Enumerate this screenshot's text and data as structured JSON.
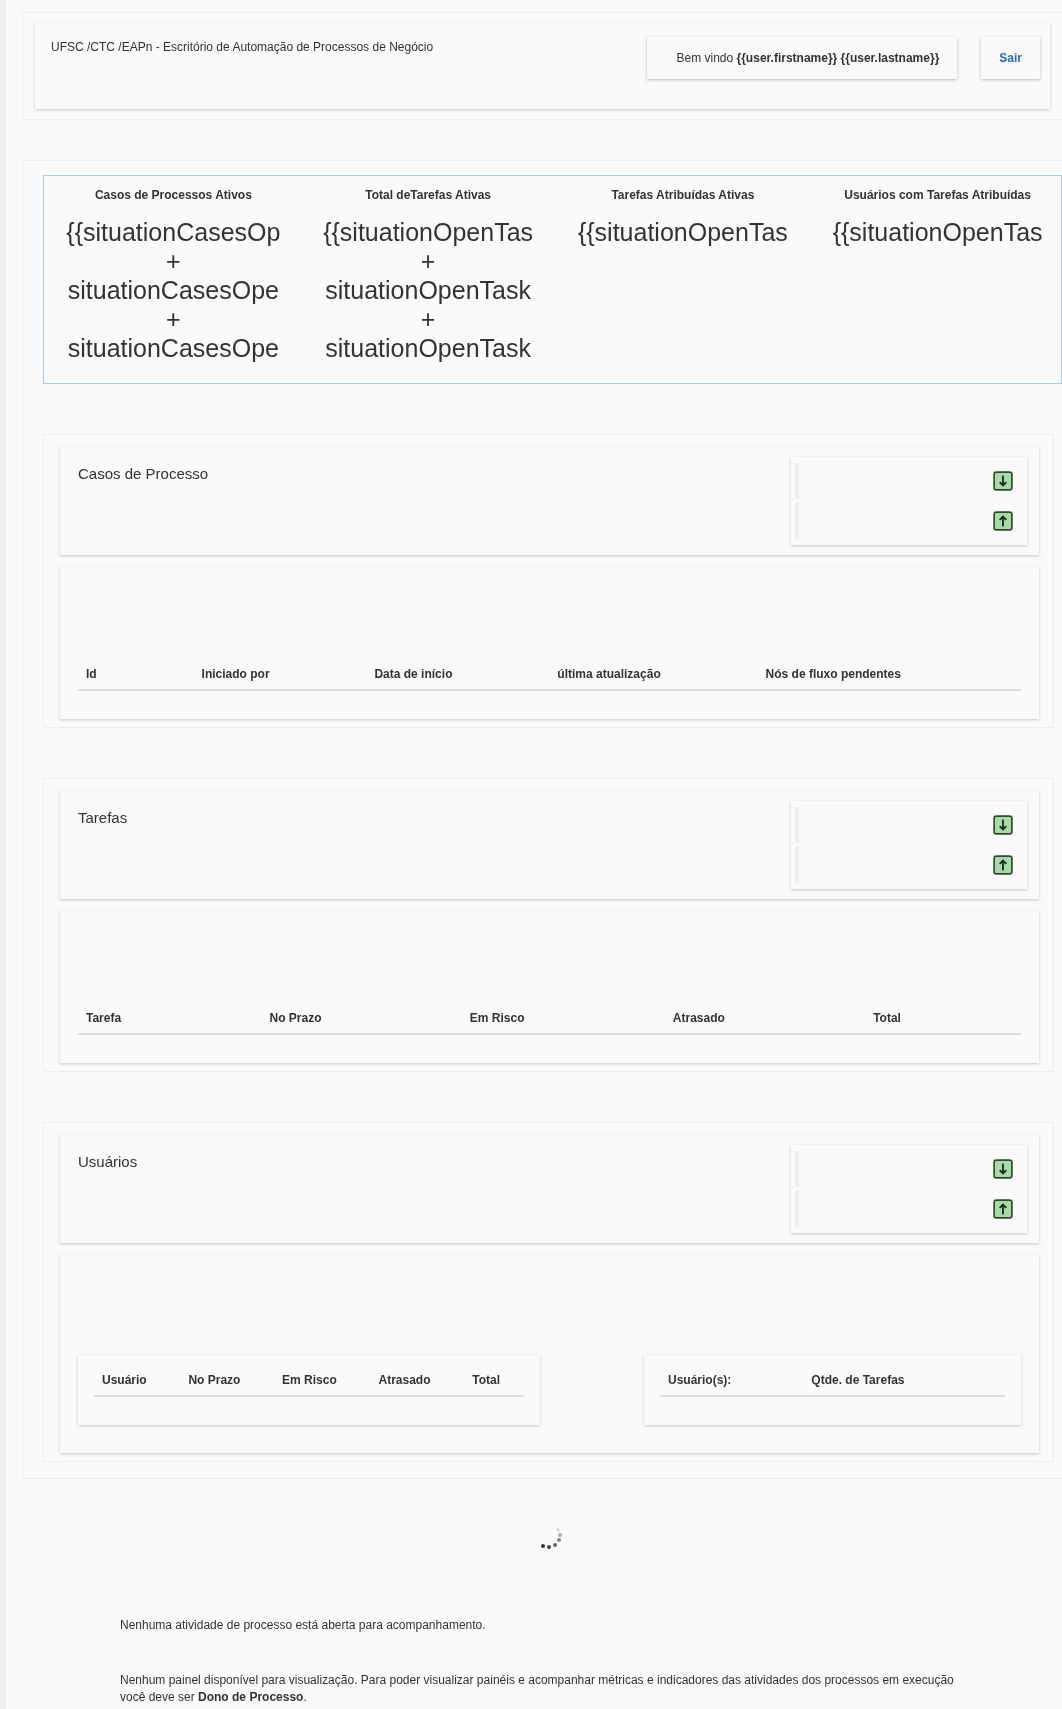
{
  "header": {
    "brand": "UFSC /CTC /EAPn - Escritório de Automação de Processos de Negócio",
    "welcome": "Bem vindo **{{user.firstname}} {{user.lastname}}**",
    "logout": "Sair"
  },
  "stats": [
    {
      "label": "Casos de Processos Ativos",
      "lines": [
        "{{situationCasesOp",
        "+",
        "situationCasesOpe",
        "+",
        "situationCasesOpe"
      ]
    },
    {
      "label": "Total deTarefas Ativas",
      "lines": [
        "{{situationOpenTas",
        "+",
        "situationOpenTask",
        "+",
        "situationOpenTask"
      ]
    },
    {
      "label": "Tarefas Atribuídas Ativas",
      "lines": [
        "{{situationOpenTas"
      ]
    },
    {
      "label": "Usuários com Tarefas Atribuídas",
      "lines": [
        "{{situationOpenTas"
      ]
    }
  ],
  "sections": [
    {
      "title": "Casos de Processo",
      "tables": [
        {
          "columns": [
            "Id",
            "Iniciado por",
            "Data de início",
            "última atualização",
            "Nós de fluxo pendentes"
          ]
        }
      ]
    },
    {
      "title": "Tarefas",
      "tables": [
        {
          "columns": [
            "Tarefa",
            "No Prazo",
            "Em Risco",
            "Atrasado",
            "Total"
          ]
        }
      ]
    },
    {
      "title": "Usuários",
      "tables": [
        {
          "columns": [
            "Usuário",
            "No Prazo",
            "Em Risco",
            "Atrasado",
            "Total"
          ]
        },
        {
          "columns": [
            "Usuário(s):",
            "Qtde. de Tarefas"
          ]
        }
      ]
    }
  ],
  "messages": [
    "Nenhuma atividade de processo está aberta para acompanhamento.",
    "Nenhum painel disponível para visualização. Para poder visualizar painéis e acompanhar métricas e indicadores das atividades dos processos em execução você deve ser **Dono de Processo**."
  ]
}
